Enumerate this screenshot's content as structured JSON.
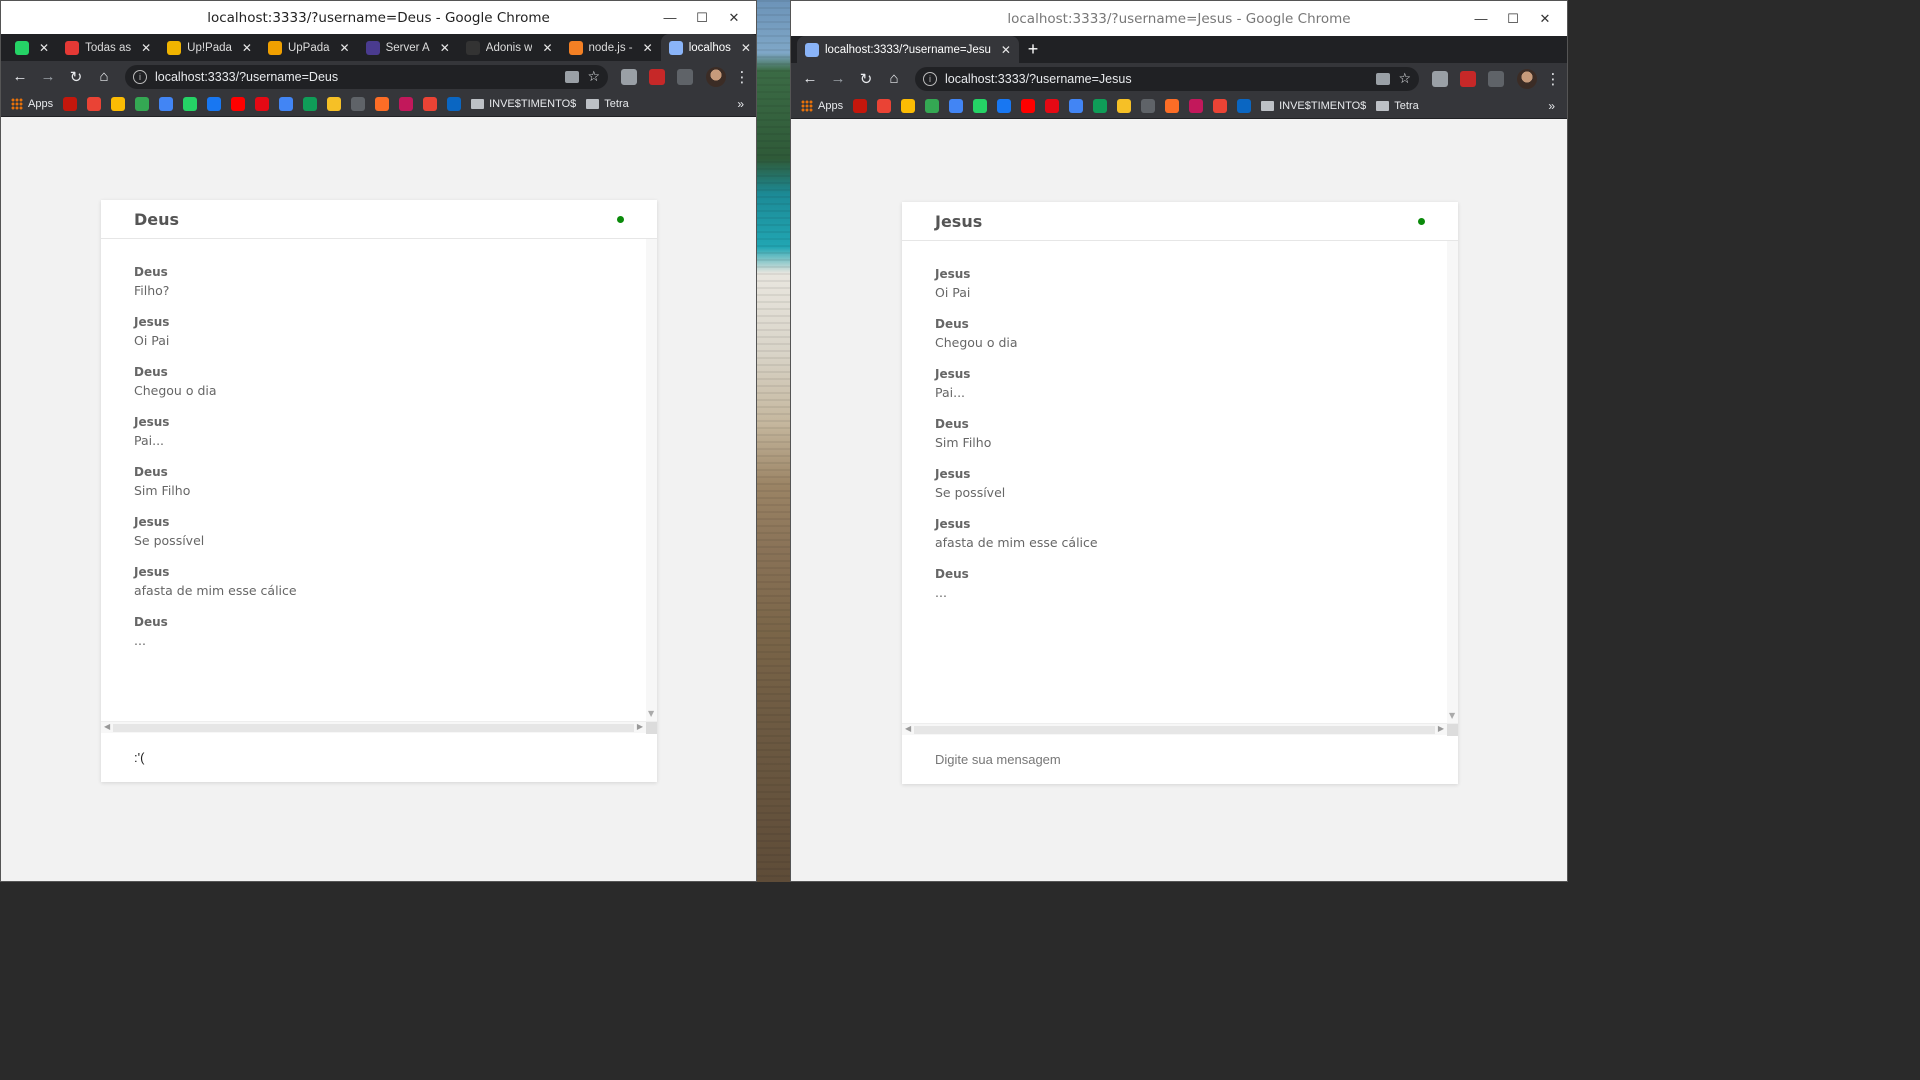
{
  "left_window": {
    "title": "localhost:3333/?username=Deus - Google Chrome",
    "tabs": [
      {
        "label": "",
        "color": "#25d366",
        "icon": "whatsapp-icon"
      },
      {
        "label": "Todas as",
        "color": "#e53935",
        "icon": "play-icon"
      },
      {
        "label": "Up!Pada",
        "color": "#f0b400",
        "icon": "page-icon"
      },
      {
        "label": "UpPada",
        "color": "#f0a000",
        "icon": "page-icon"
      },
      {
        "label": "Server A",
        "color": "#4a3b8f",
        "icon": "triangle-icon"
      },
      {
        "label": "Adonis w",
        "color": "#333333",
        "icon": "github-icon"
      },
      {
        "label": "node.js -",
        "color": "#f48024",
        "icon": "stackoverflow-icon"
      },
      {
        "label": "localhos",
        "color": "#8ab4f8",
        "icon": "globe-icon",
        "active": true
      }
    ],
    "url": "localhost:3333/?username=Deus",
    "chat": {
      "title": "Deus",
      "messages": [
        {
          "author": "Deus",
          "text": "Filho?"
        },
        {
          "author": "Jesus",
          "text": "Oi Pai"
        },
        {
          "author": "Deus",
          "text": "Chegou o dia"
        },
        {
          "author": "Jesus",
          "text": "Pai..."
        },
        {
          "author": "Deus",
          "text": "Sim Filho"
        },
        {
          "author": "Jesus",
          "text": "Se possível"
        },
        {
          "author": "Jesus",
          "text": "afasta de mim esse cálice"
        },
        {
          "author": "Deus",
          "text": "..."
        }
      ],
      "input_value": ":'(",
      "input_placeholder": "Digite sua mensagem"
    }
  },
  "right_window": {
    "title": "localhost:3333/?username=Jesus - Google Chrome",
    "tabs": [
      {
        "label": "localhost:3333/?username=Jesu",
        "color": "#8ab4f8",
        "icon": "globe-icon",
        "active": true
      }
    ],
    "url": "localhost:3333/?username=Jesus",
    "chat": {
      "title": "Jesus",
      "messages": [
        {
          "author": "Jesus",
          "text": "Oi Pai"
        },
        {
          "author": "Deus",
          "text": "Chegou o dia"
        },
        {
          "author": "Jesus",
          "text": "Pai..."
        },
        {
          "author": "Deus",
          "text": "Sim Filho"
        },
        {
          "author": "Jesus",
          "text": "Se possível"
        },
        {
          "author": "Jesus",
          "text": "afasta de mim esse cálice"
        },
        {
          "author": "Deus",
          "text": "..."
        }
      ],
      "input_value": "",
      "input_placeholder": "Digite sua mensagem"
    }
  },
  "bookmarks": {
    "apps_label": "Apps",
    "folder1": "INVE$TIMENTO$",
    "folder2": "Tetra",
    "icons": [
      {
        "name": "g1-icon",
        "color": "#c4170c"
      },
      {
        "name": "gmail-icon",
        "color": "#ea4335"
      },
      {
        "name": "photos-icon",
        "color": "#fbbc04"
      },
      {
        "name": "drive-icon",
        "color": "#34a853"
      },
      {
        "name": "calendar-icon",
        "color": "#4285f4"
      },
      {
        "name": "whatsapp-icon",
        "color": "#25d366"
      },
      {
        "name": "facebook-icon",
        "color": "#1877f2"
      },
      {
        "name": "youtube-icon",
        "color": "#ff0000"
      },
      {
        "name": "netflix-icon",
        "color": "#e50914"
      },
      {
        "name": "translate-icon",
        "color": "#4285f4"
      },
      {
        "name": "sheets-icon",
        "color": "#0f9d58"
      },
      {
        "name": "keep-icon",
        "color": "#f6c026"
      },
      {
        "name": "github-icon",
        "color": "#5f6368"
      },
      {
        "name": "gitlab-icon",
        "color": "#fc6d26"
      },
      {
        "name": "slack-icon",
        "color": "#c2185b"
      },
      {
        "name": "calendar21-icon",
        "color": "#ea4335"
      },
      {
        "name": "linkedin-icon",
        "color": "#0a66c2"
      }
    ]
  },
  "window_controls": {
    "minimize": "—",
    "maximize": "☐",
    "close": "✕"
  },
  "colors": {
    "online": "#0a8a0a",
    "chrome_dark": "#35363a",
    "page_bg": "#f2f2f2"
  }
}
